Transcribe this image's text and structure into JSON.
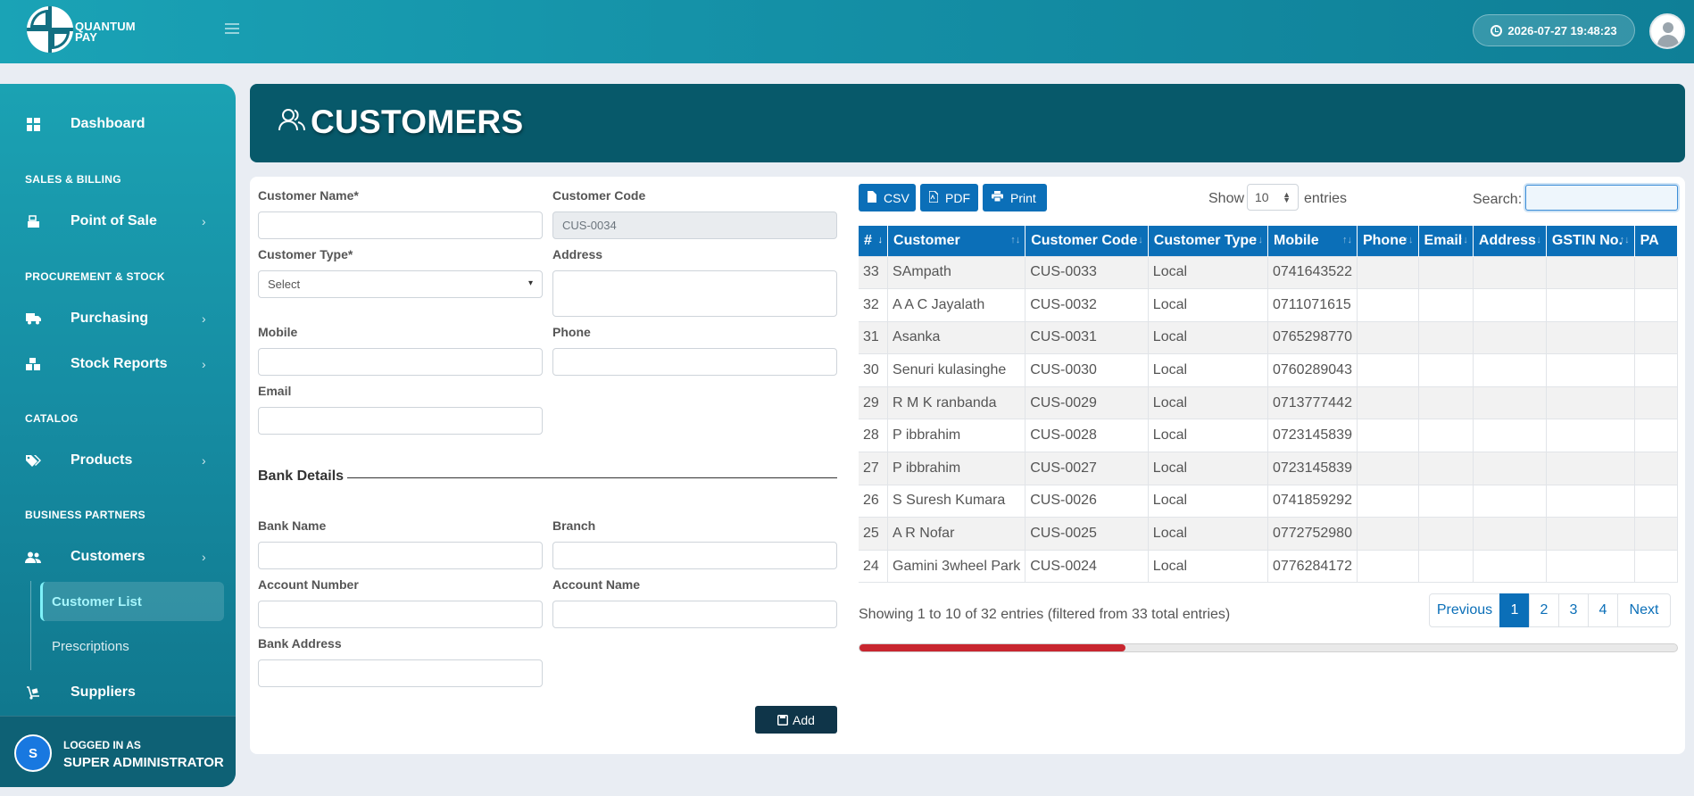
{
  "app": {
    "logo_line1": "QUANTUM",
    "logo_line2": "PAY",
    "datetime": "2026-07-27 19:48:23"
  },
  "sidebar": {
    "dashboard": "Dashboard",
    "sections": {
      "sales": "SALES & BILLING",
      "procurement": "PROCUREMENT & STOCK",
      "catalog": "CATALOG",
      "partners": "BUSINESS PARTNERS"
    },
    "items": {
      "pos": "Point of Sale",
      "purchasing": "Purchasing",
      "stock_reports": "Stock Reports",
      "products": "Products",
      "customers": "Customers",
      "customer_list": "Customer List",
      "prescriptions": "Prescriptions",
      "suppliers": "Suppliers"
    },
    "user": {
      "initial": "S",
      "logged_in_as": "LOGGED IN AS",
      "role": "SUPER ADMINISTRATOR"
    }
  },
  "page": {
    "title": "CUSTOMERS"
  },
  "form": {
    "customer_name_label": "Customer Name*",
    "customer_code_label": "Customer Code",
    "customer_code_value": "CUS-0034",
    "customer_type_label": "Customer Type*",
    "customer_type_value": "Select",
    "address_label": "Address",
    "mobile_label": "Mobile",
    "phone_label": "Phone",
    "email_label": "Email",
    "bank_details_title": "Bank Details",
    "bank_name_label": "Bank Name",
    "branch_label": "Branch",
    "account_number_label": "Account Number",
    "account_name_label": "Account Name",
    "bank_address_label": "Bank Address",
    "add_button": "Add"
  },
  "table_controls": {
    "csv": "CSV",
    "pdf": "PDF",
    "print": "Print",
    "show": "Show",
    "length": "10",
    "entries": "entries",
    "search": "Search:"
  },
  "table": {
    "columns": [
      "#",
      "Customer",
      "Customer Code",
      "Customer Type",
      "Mobile",
      "Phone",
      "Email",
      "Address",
      "GSTIN No.",
      "PA"
    ],
    "rows": [
      [
        "33",
        "SAmpath",
        "CUS-0033",
        "Local",
        "0741643522",
        "",
        "",
        "",
        "",
        ""
      ],
      [
        "32",
        "A A C Jayalath",
        "CUS-0032",
        "Local",
        "0711071615",
        "",
        "",
        "",
        "",
        ""
      ],
      [
        "31",
        "Asanka",
        "CUS-0031",
        "Local",
        "0765298770",
        "",
        "",
        "",
        "",
        ""
      ],
      [
        "30",
        "Senuri kulasinghe",
        "CUS-0030",
        "Local",
        "0760289043",
        "",
        "",
        "",
        "",
        ""
      ],
      [
        "29",
        "R M K ranbanda",
        "CUS-0029",
        "Local",
        "0713777442",
        "",
        "",
        "",
        "",
        ""
      ],
      [
        "28",
        "P ibbrahim",
        "CUS-0028",
        "Local",
        "0723145839",
        "",
        "",
        "",
        "",
        ""
      ],
      [
        "27",
        "P ibbrahim",
        "CUS-0027",
        "Local",
        "0723145839",
        "",
        "",
        "",
        "",
        ""
      ],
      [
        "26",
        "S Suresh Kumara",
        "CUS-0026",
        "Local",
        "0741859292",
        "",
        "",
        "",
        "",
        ""
      ],
      [
        "25",
        "A R Nofar",
        "CUS-0025",
        "Local",
        "0772752980",
        "",
        "",
        "",
        "",
        ""
      ],
      [
        "24",
        "Gamini 3wheel Park",
        "CUS-0024",
        "Local",
        "0776284172",
        "",
        "",
        "",
        "",
        ""
      ]
    ],
    "info": "Showing 1 to 10 of 32 entries (filtered from 33 total entries)",
    "pagination": [
      "Previous",
      "1",
      "2",
      "3",
      "4",
      "Next"
    ],
    "active_page": "1",
    "horizontal_scroll_fraction": 0.325
  }
}
